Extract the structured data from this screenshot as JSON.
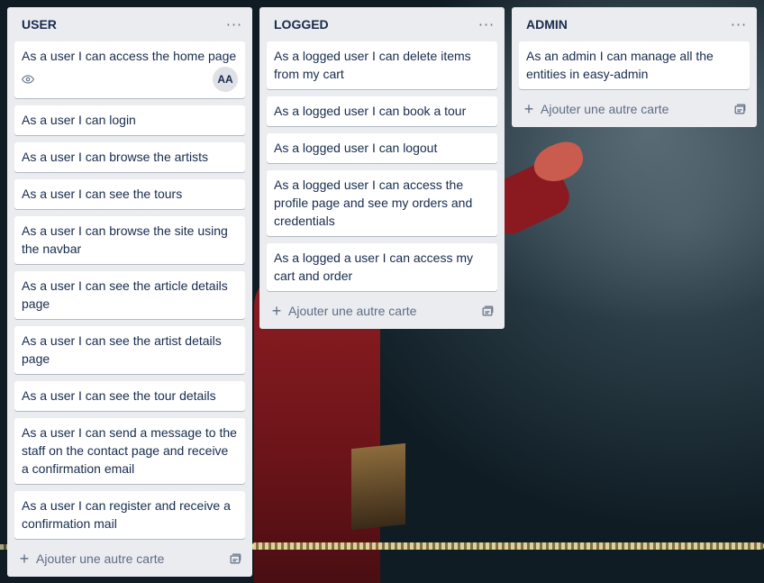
{
  "board": {
    "lists": [
      {
        "title": "USER",
        "menu_label": "···",
        "cards": [
          {
            "text": "As a user I can access the home page",
            "badges": {
              "icons": [
                "eye-icon"
              ],
              "avatar": "AA"
            }
          },
          {
            "text": "As a user I can login"
          },
          {
            "text": "As a user I can browse the artists"
          },
          {
            "text": "As a user I can see the tours"
          },
          {
            "text": "As a user I can browse the site using the navbar"
          },
          {
            "text": "As a user I can see the article details page"
          },
          {
            "text": "As a user I can see the artist details page"
          },
          {
            "text": "As a user I can see the tour details"
          },
          {
            "text": "As a user I can send a message to the staff on the contact page and receive a confirmation email"
          },
          {
            "text": "As a user I can register and receive a confirmation mail"
          }
        ],
        "add_card_label": "Ajouter une autre carte"
      },
      {
        "title": "LOGGED",
        "menu_label": "···",
        "cards": [
          {
            "text": "As a logged user I can delete items from my cart"
          },
          {
            "text": "As a logged user I can book a tour"
          },
          {
            "text": "As a logged user I can logout"
          },
          {
            "text": "As a logged user I can access the profile page and see my orders and credentials"
          },
          {
            "text": "As a logged a user I can access my cart and order"
          }
        ],
        "add_card_label": "Ajouter une autre carte"
      },
      {
        "title": "ADMIN",
        "menu_label": "···",
        "cards": [
          {
            "text": "As an admin I can manage all the entities in easy-admin"
          }
        ],
        "add_card_label": "Ajouter une autre carte"
      }
    ]
  }
}
